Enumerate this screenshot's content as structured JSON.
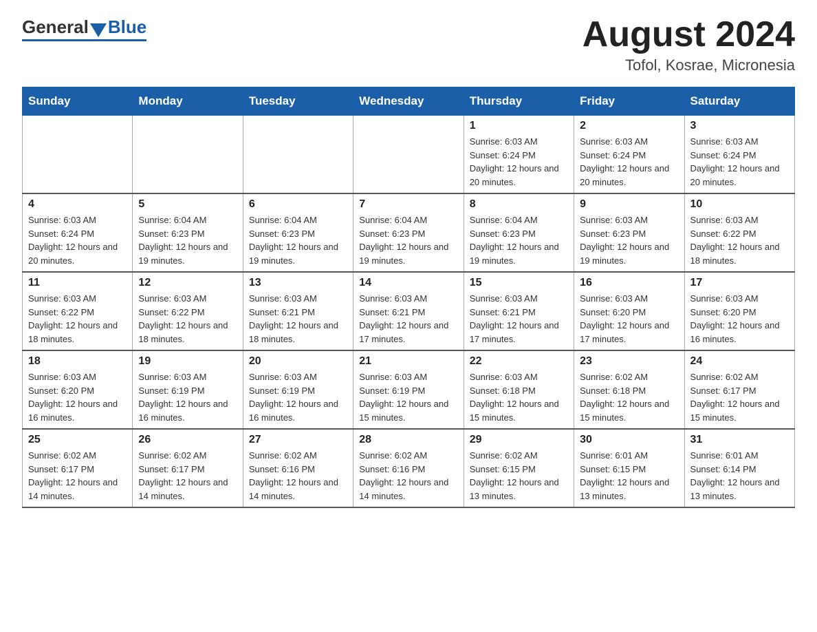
{
  "logo": {
    "general": "General",
    "blue": "Blue"
  },
  "header": {
    "month_year": "August 2024",
    "location": "Tofol, Kosrae, Micronesia"
  },
  "weekdays": [
    "Sunday",
    "Monday",
    "Tuesday",
    "Wednesday",
    "Thursday",
    "Friday",
    "Saturday"
  ],
  "weeks": [
    [
      {
        "day": "",
        "info": ""
      },
      {
        "day": "",
        "info": ""
      },
      {
        "day": "",
        "info": ""
      },
      {
        "day": "",
        "info": ""
      },
      {
        "day": "1",
        "info": "Sunrise: 6:03 AM\nSunset: 6:24 PM\nDaylight: 12 hours and 20 minutes."
      },
      {
        "day": "2",
        "info": "Sunrise: 6:03 AM\nSunset: 6:24 PM\nDaylight: 12 hours and 20 minutes."
      },
      {
        "day": "3",
        "info": "Sunrise: 6:03 AM\nSunset: 6:24 PM\nDaylight: 12 hours and 20 minutes."
      }
    ],
    [
      {
        "day": "4",
        "info": "Sunrise: 6:03 AM\nSunset: 6:24 PM\nDaylight: 12 hours and 20 minutes."
      },
      {
        "day": "5",
        "info": "Sunrise: 6:04 AM\nSunset: 6:23 PM\nDaylight: 12 hours and 19 minutes."
      },
      {
        "day": "6",
        "info": "Sunrise: 6:04 AM\nSunset: 6:23 PM\nDaylight: 12 hours and 19 minutes."
      },
      {
        "day": "7",
        "info": "Sunrise: 6:04 AM\nSunset: 6:23 PM\nDaylight: 12 hours and 19 minutes."
      },
      {
        "day": "8",
        "info": "Sunrise: 6:04 AM\nSunset: 6:23 PM\nDaylight: 12 hours and 19 minutes."
      },
      {
        "day": "9",
        "info": "Sunrise: 6:03 AM\nSunset: 6:23 PM\nDaylight: 12 hours and 19 minutes."
      },
      {
        "day": "10",
        "info": "Sunrise: 6:03 AM\nSunset: 6:22 PM\nDaylight: 12 hours and 18 minutes."
      }
    ],
    [
      {
        "day": "11",
        "info": "Sunrise: 6:03 AM\nSunset: 6:22 PM\nDaylight: 12 hours and 18 minutes."
      },
      {
        "day": "12",
        "info": "Sunrise: 6:03 AM\nSunset: 6:22 PM\nDaylight: 12 hours and 18 minutes."
      },
      {
        "day": "13",
        "info": "Sunrise: 6:03 AM\nSunset: 6:21 PM\nDaylight: 12 hours and 18 minutes."
      },
      {
        "day": "14",
        "info": "Sunrise: 6:03 AM\nSunset: 6:21 PM\nDaylight: 12 hours and 17 minutes."
      },
      {
        "day": "15",
        "info": "Sunrise: 6:03 AM\nSunset: 6:21 PM\nDaylight: 12 hours and 17 minutes."
      },
      {
        "day": "16",
        "info": "Sunrise: 6:03 AM\nSunset: 6:20 PM\nDaylight: 12 hours and 17 minutes."
      },
      {
        "day": "17",
        "info": "Sunrise: 6:03 AM\nSunset: 6:20 PM\nDaylight: 12 hours and 16 minutes."
      }
    ],
    [
      {
        "day": "18",
        "info": "Sunrise: 6:03 AM\nSunset: 6:20 PM\nDaylight: 12 hours and 16 minutes."
      },
      {
        "day": "19",
        "info": "Sunrise: 6:03 AM\nSunset: 6:19 PM\nDaylight: 12 hours and 16 minutes."
      },
      {
        "day": "20",
        "info": "Sunrise: 6:03 AM\nSunset: 6:19 PM\nDaylight: 12 hours and 16 minutes."
      },
      {
        "day": "21",
        "info": "Sunrise: 6:03 AM\nSunset: 6:19 PM\nDaylight: 12 hours and 15 minutes."
      },
      {
        "day": "22",
        "info": "Sunrise: 6:03 AM\nSunset: 6:18 PM\nDaylight: 12 hours and 15 minutes."
      },
      {
        "day": "23",
        "info": "Sunrise: 6:02 AM\nSunset: 6:18 PM\nDaylight: 12 hours and 15 minutes."
      },
      {
        "day": "24",
        "info": "Sunrise: 6:02 AM\nSunset: 6:17 PM\nDaylight: 12 hours and 15 minutes."
      }
    ],
    [
      {
        "day": "25",
        "info": "Sunrise: 6:02 AM\nSunset: 6:17 PM\nDaylight: 12 hours and 14 minutes."
      },
      {
        "day": "26",
        "info": "Sunrise: 6:02 AM\nSunset: 6:17 PM\nDaylight: 12 hours and 14 minutes."
      },
      {
        "day": "27",
        "info": "Sunrise: 6:02 AM\nSunset: 6:16 PM\nDaylight: 12 hours and 14 minutes."
      },
      {
        "day": "28",
        "info": "Sunrise: 6:02 AM\nSunset: 6:16 PM\nDaylight: 12 hours and 14 minutes."
      },
      {
        "day": "29",
        "info": "Sunrise: 6:02 AM\nSunset: 6:15 PM\nDaylight: 12 hours and 13 minutes."
      },
      {
        "day": "30",
        "info": "Sunrise: 6:01 AM\nSunset: 6:15 PM\nDaylight: 12 hours and 13 minutes."
      },
      {
        "day": "31",
        "info": "Sunrise: 6:01 AM\nSunset: 6:14 PM\nDaylight: 12 hours and 13 minutes."
      }
    ]
  ]
}
